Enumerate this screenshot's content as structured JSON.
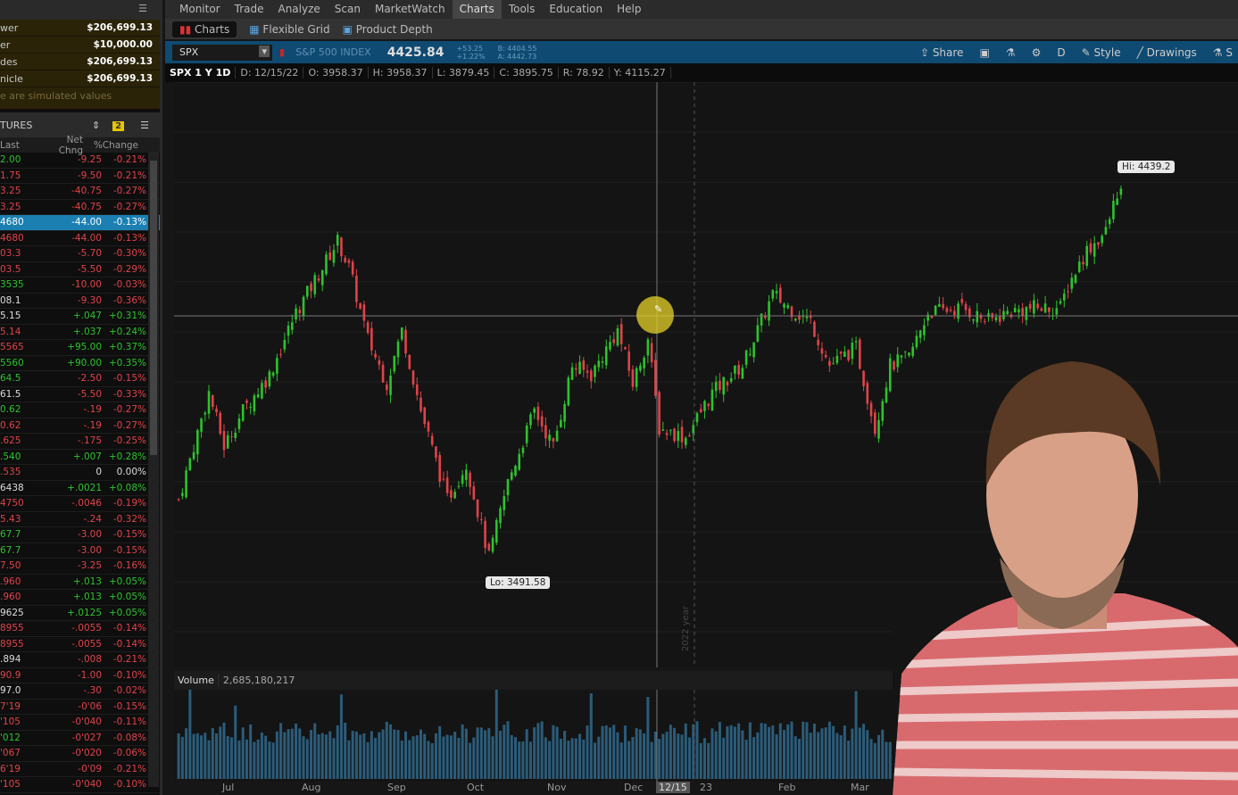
{
  "account": {
    "rows": [
      {
        "label": "wer",
        "value": "$206,699.13"
      },
      {
        "label": "er",
        "value": "$10,000.00"
      },
      {
        "label": "des",
        "value": "$206,699.13"
      },
      {
        "label": "nicle",
        "value": "$206,699.13"
      }
    ],
    "note": "e are simulated values"
  },
  "watchlist": {
    "title": "TURES",
    "badge": "2",
    "columns": [
      "Last",
      "Net Chng",
      "%Change"
    ],
    "rows": [
      [
        "2.00",
        "up",
        "-9.25",
        "-0.21%"
      ],
      [
        "1.75",
        "down",
        "-9.50",
        "-0.21%"
      ],
      [
        "3.25",
        "down",
        "-40.75",
        "-0.27%"
      ],
      [
        "3.25",
        "down",
        "-40.75",
        "-0.27%"
      ],
      [
        "4680",
        "sel",
        "-44.00",
        "-0.13%"
      ],
      [
        "4680",
        "down",
        "-44.00",
        "-0.13%"
      ],
      [
        "03.3",
        "down",
        "-5.70",
        "-0.30%"
      ],
      [
        "03.5",
        "down",
        "-5.50",
        "-0.29%"
      ],
      [
        "3535",
        "up",
        "-10.00",
        "-0.03%"
      ],
      [
        "08.1",
        "flat",
        "-9.30",
        "-0.36%"
      ],
      [
        "5.15",
        "flat",
        "+.047",
        "+0.31%"
      ],
      [
        "5.14",
        "down",
        "+.037",
        "+0.24%"
      ],
      [
        "5565",
        "down",
        "+95.00",
        "+0.37%"
      ],
      [
        "5560",
        "up",
        "+90.00",
        "+0.35%"
      ],
      [
        "64.5",
        "up",
        "-2.50",
        "-0.15%"
      ],
      [
        "61.5",
        "flat",
        "-5.50",
        "-0.33%"
      ],
      [
        "0.62",
        "up",
        "-.19",
        "-0.27%"
      ],
      [
        "0.62",
        "down",
        "-.19",
        "-0.27%"
      ],
      [
        ".625",
        "down",
        "-.175",
        "-0.25%"
      ],
      [
        ".540",
        "up",
        "+.007",
        "+0.28%"
      ],
      [
        ".535",
        "down",
        "0",
        "0.00%"
      ],
      [
        "6438",
        "flat",
        "+.0021",
        "+0.08%"
      ],
      [
        "4750",
        "down",
        "-.0046",
        "-0.19%"
      ],
      [
        "5.43",
        "down",
        "-.24",
        "-0.32%"
      ],
      [
        "67.7",
        "up",
        "-3.00",
        "-0.15%"
      ],
      [
        "67.7",
        "up",
        "-3.00",
        "-0.15%"
      ],
      [
        "7.50",
        "down",
        "-3.25",
        "-0.16%"
      ],
      [
        ".960",
        "down",
        "+.013",
        "+0.05%"
      ],
      [
        ".960",
        "down",
        "+.013",
        "+0.05%"
      ],
      [
        "9625",
        "flat",
        "+.0125",
        "+0.05%"
      ],
      [
        "8955",
        "down",
        "-.0055",
        "-0.14%"
      ],
      [
        "8955",
        "down",
        "-.0055",
        "-0.14%"
      ],
      [
        ".894",
        "flat",
        "-.008",
        "-0.21%"
      ],
      [
        "90.9",
        "down",
        "-1.00",
        "-0.10%"
      ],
      [
        "97.0",
        "flat",
        "-.30",
        "-0.02%"
      ],
      [
        "7'19",
        "down",
        "-0'06",
        "-0.15%"
      ],
      [
        "'105",
        "down",
        "-0'040",
        "-0.11%"
      ],
      [
        "'012",
        "up",
        "-0'027",
        "-0.08%"
      ],
      [
        "'067",
        "down",
        "-0'020",
        "-0.06%"
      ],
      [
        "6'19",
        "down",
        "-0'09",
        "-0.21%"
      ],
      [
        "'105",
        "down",
        "-0'040",
        "-0.10%"
      ]
    ]
  },
  "nav": [
    "Monitor",
    "Trade",
    "Analyze",
    "Scan",
    "MarketWatch",
    "Charts",
    "Tools",
    "Education",
    "Help"
  ],
  "subnav": [
    "Charts",
    "Flexible Grid",
    "Product Depth"
  ],
  "symbol": {
    "ticker": "SPX",
    "name": "S&P 500 INDEX",
    "last": "4425.84",
    "chg": "+53.25",
    "pct": "+1.22%",
    "bid": "B: 4404.55",
    "ask": "A: 4442.73"
  },
  "toolbar": {
    "share": "Share",
    "period": "D",
    "style": "Style",
    "drawings": "Drawings"
  },
  "info": [
    "SPX 1 Y 1D",
    "D: 12/15/22",
    "O: 3958.37",
    "H: 3958.37",
    "L: 3879.45",
    "C: 3895.75",
    "R: 78.92",
    "Y: 4115.27"
  ],
  "colors": {
    "up": "#2ec22e",
    "down": "#e0434a",
    "accent": "#0f4a72"
  },
  "chart_data": {
    "type": "candlestick",
    "title": "SPX 1 Y 1D",
    "hi_label": "Hi: 4439.2",
    "lo_label": "Lo: 3491.58",
    "hi": 4439.2,
    "lo": 3491.58,
    "anchor_days": [
      0,
      8,
      12,
      17,
      24,
      31,
      38,
      42,
      45,
      50,
      55,
      59,
      64,
      71,
      76,
      82,
      87,
      94,
      99,
      104,
      109,
      116,
      120,
      124,
      127,
      134,
      141,
      149,
      157,
      163,
      167,
      172,
      179,
      184,
      188,
      193,
      198,
      207,
      214,
      219,
      226,
      233,
      235,
      240,
      245,
      248
    ],
    "anchor_closes": [
      3649,
      3918,
      3783,
      3873,
      3963,
      4120,
      4233,
      4300,
      4233,
      4053,
      3941,
      4075,
      3873,
      3649,
      3739,
      3503,
      3693,
      3873,
      3783,
      3986,
      3963,
      4075,
      3941,
      4053,
      3828,
      3806,
      3918,
      3986,
      4165,
      4120,
      4098,
      3986,
      4031,
      3828,
      3986,
      4008,
      4120,
      4131,
      4098,
      4120,
      4131,
      4131,
      4188,
      4277,
      4322,
      4423
    ],
    "year_marker": "2022 year",
    "volume_label": "Volume",
    "volume_value": "2,685,180,217",
    "x_ticks": [
      "Jul",
      "Aug",
      "Sep",
      "Oct",
      "Nov",
      "Dec",
      "12/15",
      "23",
      "Feb",
      "Mar"
    ]
  }
}
